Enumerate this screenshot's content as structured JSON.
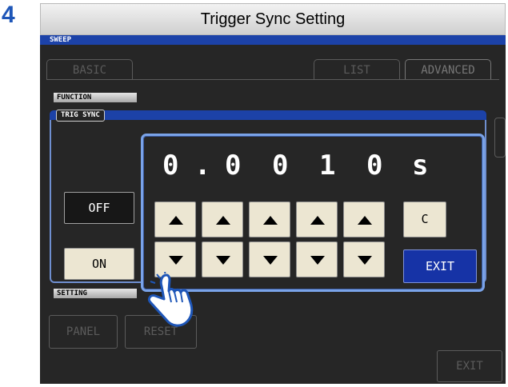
{
  "step": {
    "number": "4"
  },
  "header": {
    "title": "Trigger Sync Setting"
  },
  "screen": {
    "mode_label": "SWEEP",
    "tabs": [
      {
        "label": "BASIC"
      },
      {
        "label": "LIST"
      },
      {
        "label": "ADVANCED"
      }
    ],
    "function_label": "FUNCTION",
    "setting_label": "SETTING",
    "bottom_buttons": {
      "panel": "PANEL",
      "reset": "RESET",
      "exit": "EXIT"
    }
  },
  "dialog": {
    "title": "TRIG SYNC",
    "off_label": "OFF",
    "on_label": "ON",
    "selected": "OFF"
  },
  "numpad": {
    "digits": [
      "0",
      ".",
      "0",
      "0",
      "1",
      "0"
    ],
    "unit": "s",
    "clear_label": "C",
    "exit_label": "EXIT"
  },
  "colors": {
    "accent_blue": "#1c42a8",
    "highlight_border": "#7aa3e8",
    "button_face": "#ece6d2",
    "exit_button": "#1633a6",
    "step_number": "#1e56b8"
  },
  "icons": {
    "pointer": "pointing-hand-icon"
  }
}
